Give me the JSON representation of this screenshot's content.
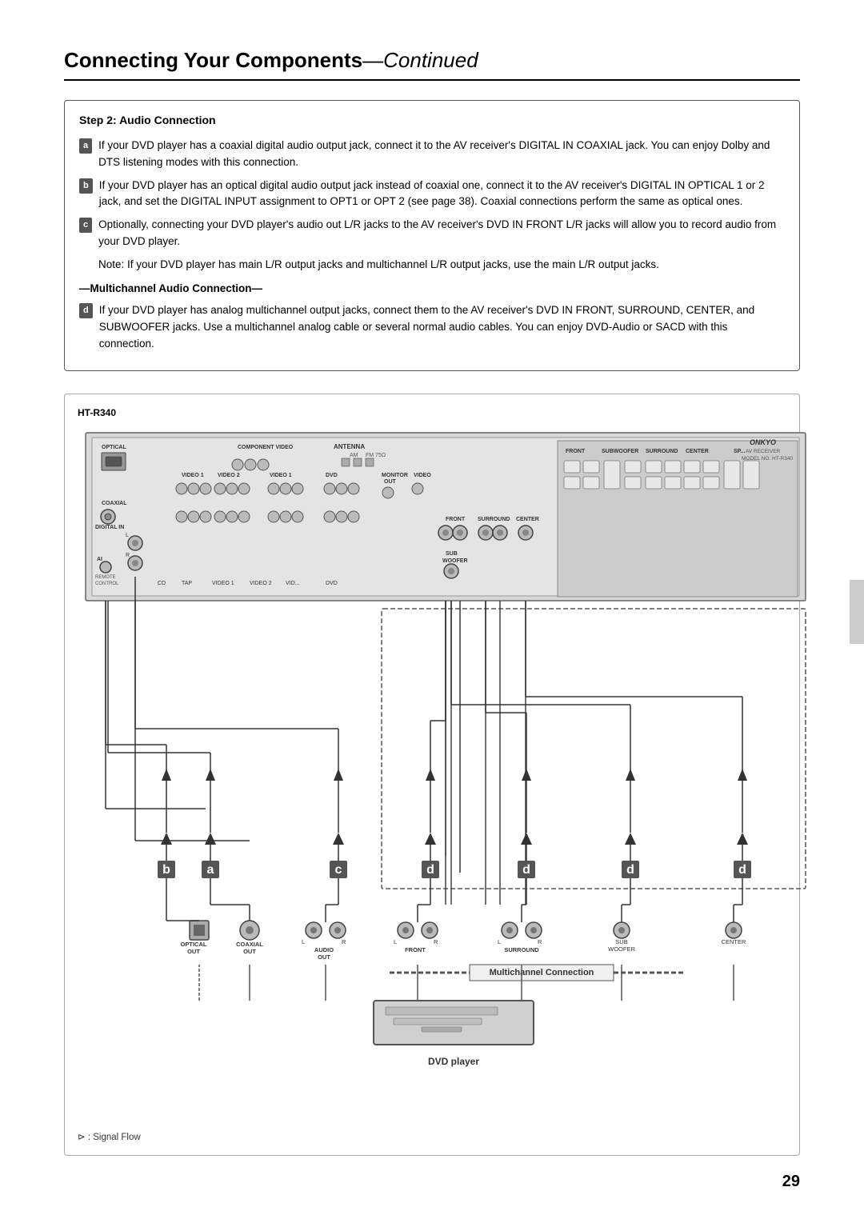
{
  "page": {
    "title": "Connecting Your Components",
    "title_continued": "—Continued",
    "page_number": "29"
  },
  "step": {
    "number": "Step 2:",
    "title": "Audio Connection"
  },
  "instructions": {
    "item_a": {
      "label": "a",
      "text": "If your DVD player has a coaxial digital audio output jack, connect it to the AV receiver's DIGITAL IN COAXIAL jack. You can enjoy Dolby and DTS listening modes with this connection."
    },
    "item_b": {
      "label": "b",
      "text": "If your DVD player has an optical digital audio output jack instead of coaxial one, connect it to the AV receiver's DIGITAL IN OPTICAL 1 or 2 jack, and set the DIGITAL INPUT assignment to OPT1 or OPT 2 (see page 38). Coaxial connections perform the same as optical ones."
    },
    "item_c": {
      "label": "c",
      "text": "Optionally, connecting your DVD player's audio out L/R jacks to the AV receiver's DVD IN FRONT L/R jacks will allow you to record audio from your DVD player."
    },
    "item_c_note": "Note: If your DVD player has main L/R output jacks and multichannel L/R output jacks, use the main L/R output jacks.",
    "multichannel_title": "—Multichannel Audio Connection—",
    "item_d": {
      "label": "d",
      "text": "If your DVD player has analog multichannel output jacks, connect them to the AV receiver's DVD IN FRONT, SURROUND, CENTER, and SUBWOOFER jacks. Use a multichannel analog cable or several normal audio cables. You can enjoy DVD-Audio or SACD with this connection."
    }
  },
  "diagram": {
    "receiver_label": "HT-R340",
    "brand": "ONKYO",
    "model": "AV RECEIVER MODEL NO. HT-R340",
    "sections": {
      "antenna": "ANTENNA",
      "am": "AM",
      "fm": "FM 75Ω",
      "optical": "OPTICAL",
      "component_video": "COMPONENT VIDEO",
      "video1": "VIDEO 1",
      "video2": "VIDEO 2",
      "dvd": "DVD",
      "monitor_out": "MONITOR OUT",
      "coaxial": "COAXIAL",
      "digital_in": "DIGITAL IN",
      "front": "FRONT",
      "surround": "SURROUND",
      "center": "CENTER",
      "sub_woofer": "SUB WOOFER",
      "speaker_front": "FRONT SPEAKERS",
      "speaker_surround": "SURROUND SPEAKERS",
      "speaker_center": "CENTER SPEAKERS"
    },
    "dvd_player_label": "DVD player",
    "multichannel_label": "Multichannel Connection",
    "signal_flow_note": "⊳ : Signal Flow",
    "connectors_dvd": [
      {
        "label": "OPTICAL\nOUT",
        "type": "square"
      },
      {
        "label": "COAXIAL\nOUT",
        "type": "round"
      },
      {
        "label": "L  R\nAUDIO\nOUT",
        "type": "lr"
      },
      {
        "label": "L  R\nFRONT",
        "type": "lr"
      },
      {
        "label": "L  R\nSURROUND",
        "type": "lr"
      },
      {
        "label": "L\nSUB\nWOOFER",
        "type": "single"
      },
      {
        "label": "CENTER",
        "type": "single"
      }
    ],
    "badges_diagram": [
      "b",
      "a",
      "c",
      "d",
      "d",
      "d",
      "d"
    ]
  }
}
